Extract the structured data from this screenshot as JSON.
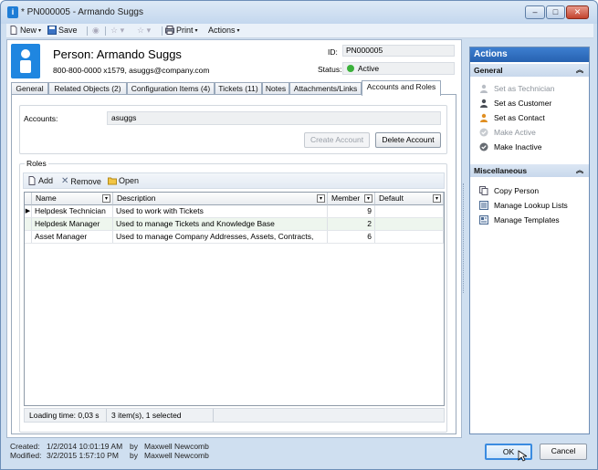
{
  "window": {
    "title": "* PN000005 - Armando Suggs",
    "minimize": "–",
    "maximize": "□",
    "close": "✕"
  },
  "toolbar": {
    "new": "New",
    "save": "Save",
    "print": "Print",
    "actions": "Actions"
  },
  "person": {
    "name": "Person: Armando Suggs",
    "contact": "800-800-0000 x1579, asuggs@company.com",
    "id_label": "ID:",
    "id_value": "PN000005",
    "status_label": "Status:",
    "status_value": "Active"
  },
  "tabs": [
    "General",
    "Related Objects (2)",
    "Configuration Items (4)",
    "Tickets (11)",
    "Notes",
    "Attachments/Links",
    "Accounts and Roles"
  ],
  "accounts": {
    "label": "Accounts:",
    "value": "asuggs",
    "create_button": "Create Account",
    "delete_button": "Delete Account"
  },
  "roles": {
    "title": "Roles",
    "add": "Add",
    "remove": "Remove",
    "open": "Open",
    "columns": [
      "Name",
      "Description",
      "Member",
      "Default"
    ],
    "rows": [
      {
        "name": "Helpdesk Technician",
        "description": "Used to work with Tickets",
        "member": "9",
        "default": ""
      },
      {
        "name": "Helpdesk Manager",
        "description": "Used to manage Tickets and Knowledge Base",
        "member": "2",
        "default": ""
      },
      {
        "name": "Asset Manager",
        "description": "Used to manage Company Addresses, Assets, Contracts,",
        "member": "6",
        "default": ""
      }
    ],
    "loading": "Loading time: 0,03 s",
    "count": "3 item(s), 1 selected"
  },
  "actions_panel": {
    "title": "Actions",
    "general_label": "General",
    "general": [
      {
        "label": "Set as Technician",
        "enabled": false
      },
      {
        "label": "Set as Customer",
        "enabled": true
      },
      {
        "label": "Set as Contact",
        "enabled": true
      },
      {
        "label": "Make Active",
        "enabled": false
      },
      {
        "label": "Make Inactive",
        "enabled": true
      }
    ],
    "misc_label": "Miscellaneous",
    "misc": [
      {
        "label": "Copy Person"
      },
      {
        "label": "Manage Lookup Lists"
      },
      {
        "label": "Manage Templates"
      }
    ]
  },
  "footer": {
    "created_label": "Created:",
    "created_date": "1/2/2014 10:01:19 AM",
    "created_by_label": "by",
    "created_by": "Maxwell Newcomb",
    "modified_label": "Modified:",
    "modified_date": "3/2/2015 1:57:10 PM",
    "modified_by_label": "by",
    "modified_by": "Maxwell Newcomb",
    "ok": "OK",
    "cancel": "Cancel"
  },
  "colors": {
    "accent": "#1f86e0",
    "active_status": "#3bb13b",
    "actions_header": "#2761b0"
  }
}
